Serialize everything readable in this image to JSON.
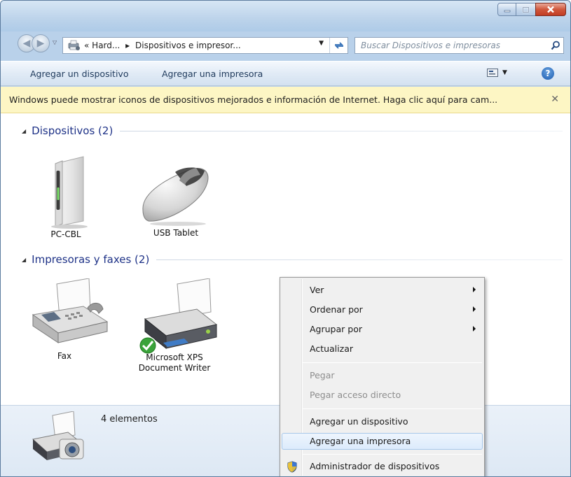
{
  "window": {
    "caption_buttons": [
      "minimize",
      "maximize",
      "close"
    ]
  },
  "address_bar": {
    "crumb_prefix": "«",
    "crumb_1": "Hard...",
    "separator": "▸",
    "crumb_2": "Dispositivos e impresor...",
    "icon": "devices-printers-icon"
  },
  "search": {
    "placeholder": "Buscar Dispositivos e impresoras",
    "icon": "search-icon"
  },
  "command_bar": {
    "add_device": "Agregar un dispositivo",
    "add_printer": "Agregar una impresora"
  },
  "info_bar": {
    "text": "Windows puede mostrar iconos de dispositivos mejorados e información de Internet. Haga clic aquí para cam...",
    "close": "✕"
  },
  "groups": {
    "devices": {
      "label": "Dispositivos (2)",
      "items": [
        {
          "label": "PC-CBL",
          "icon": "computer-tower-icon"
        },
        {
          "label": "USB Tablet",
          "icon": "mouse-icon"
        }
      ]
    },
    "printers": {
      "label": "Impresoras y faxes (2)",
      "items": [
        {
          "label": "Fax",
          "icon": "fax-icon"
        },
        {
          "label_line1": "Microsoft XPS",
          "label_line2": "Document Writer",
          "icon": "printer-icon",
          "default": true
        }
      ]
    }
  },
  "details": {
    "count": "4 elementos",
    "icon": "printer-camera-icon"
  },
  "context_menu": {
    "items": [
      {
        "label": "Ver",
        "submenu": true,
        "enabled": true
      },
      {
        "label": "Ordenar por",
        "submenu": true,
        "enabled": true
      },
      {
        "label": "Agrupar por",
        "submenu": true,
        "enabled": true
      },
      {
        "label": "Actualizar",
        "enabled": true
      },
      {
        "label": "Pegar",
        "enabled": false
      },
      {
        "label": "Pegar acceso directo",
        "enabled": false
      },
      {
        "label": "Agregar un dispositivo",
        "enabled": true
      },
      {
        "label": "Agregar una impresora",
        "enabled": true,
        "highlighted": true
      },
      {
        "label": "Administrador de dispositivos",
        "enabled": true,
        "icon": "uac-shield-icon"
      }
    ]
  }
}
